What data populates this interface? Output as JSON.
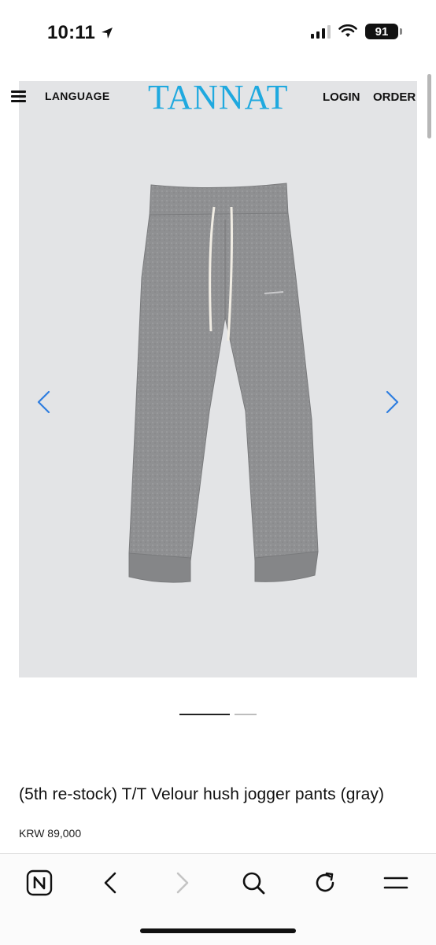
{
  "status_bar": {
    "time": "10:11",
    "battery": "91"
  },
  "site": {
    "menu_icon": "hamburger-menu-icon",
    "language": "LANGUAGE",
    "logo": "TANNAT",
    "login": "LOGIN",
    "order": "ORDER",
    "logo_color": "#1fa9df"
  },
  "gallery": {
    "prev_icon": "chevron-left-icon",
    "next_icon": "chevron-right-icon",
    "arrow_color": "#2f7ee0",
    "image_subject": "gray velour jogger pants",
    "pages_total": 2,
    "current_page": 1
  },
  "product": {
    "title": "(5th re-stock) T/T Velour hush jogger pants (gray)",
    "price": "KRW 89,000"
  },
  "browser_toolbar": {
    "items": [
      "naver-home-icon",
      "back-icon",
      "forward-icon",
      "search-icon",
      "reload-icon",
      "menu-icon"
    ]
  }
}
